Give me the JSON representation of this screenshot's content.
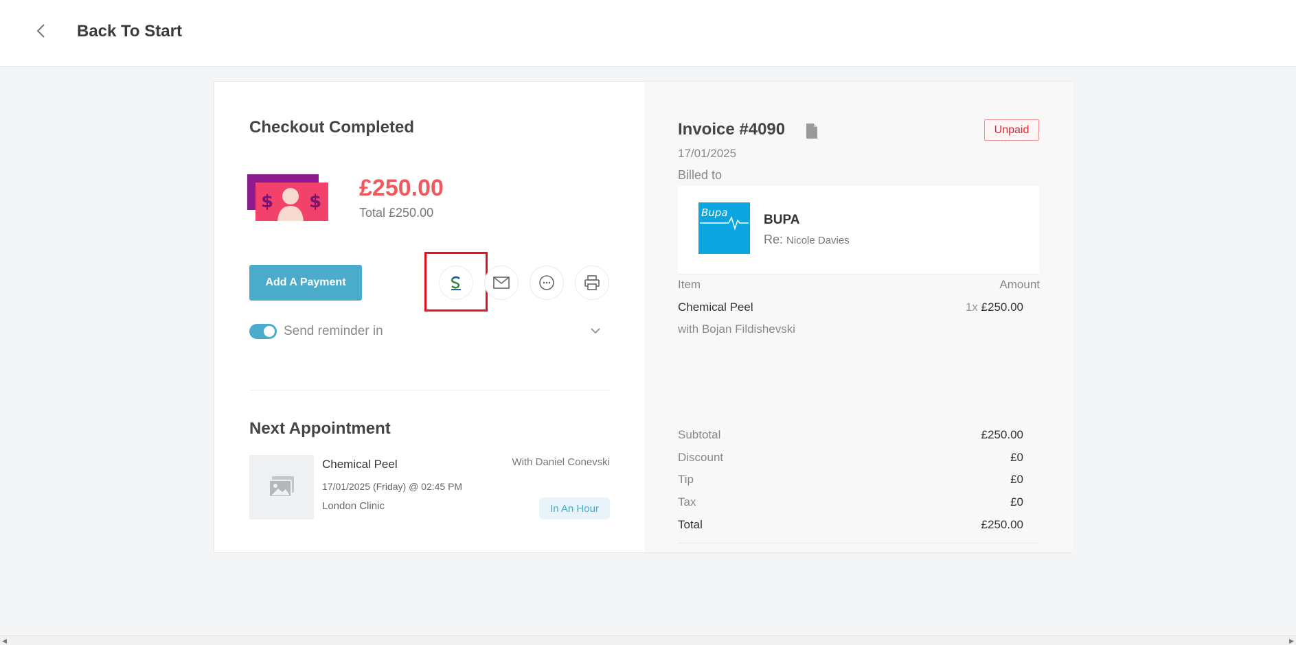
{
  "topbar": {
    "title": "Back To Start"
  },
  "checkout": {
    "title": "Checkout Completed",
    "amount": "£250.00",
    "total_text": "Total £250.00",
    "add_payment_label": "Add A Payment",
    "reminder_label": "Send reminder in",
    "reminder_enabled": true,
    "actions": [
      "payment-provider-icon",
      "email-icon",
      "sms-icon",
      "printer-icon"
    ]
  },
  "next_appointment": {
    "title": "Next Appointment",
    "service": "Chemical Peel",
    "with": "With Daniel Conevski",
    "datetime": "17/01/2025 (Friday) @ 02:45 PM",
    "location": "London Clinic",
    "badge": "In An Hour"
  },
  "invoice": {
    "title": "Invoice #4090",
    "status": "Unpaid",
    "date": "17/01/2025",
    "billed_to_label": "Billed to",
    "billed": {
      "logo_text": "Bupa",
      "name": "BUPA",
      "re_label": "Re:",
      "re_name": "Nicole Davies"
    },
    "columns": {
      "item": "Item",
      "amount": "Amount"
    },
    "items": [
      {
        "name": "Chemical Peel",
        "qty": "1x",
        "amount": "£250.00",
        "with": "with Bojan Fildishevski"
      }
    ],
    "summary": [
      {
        "label": "Subtotal",
        "value": "£250.00"
      },
      {
        "label": "Discount",
        "value": "£0"
      },
      {
        "label": "Tip",
        "value": "£0"
      },
      {
        "label": "Tax",
        "value": "£0"
      },
      {
        "label": "Total",
        "value": "£250.00"
      }
    ]
  },
  "colors": {
    "accent": "#4aabcb",
    "amount": "#ef5a5e",
    "unpaid": "#e02530",
    "bupa": "#0ba6e0",
    "highlight": "#e8101c"
  }
}
